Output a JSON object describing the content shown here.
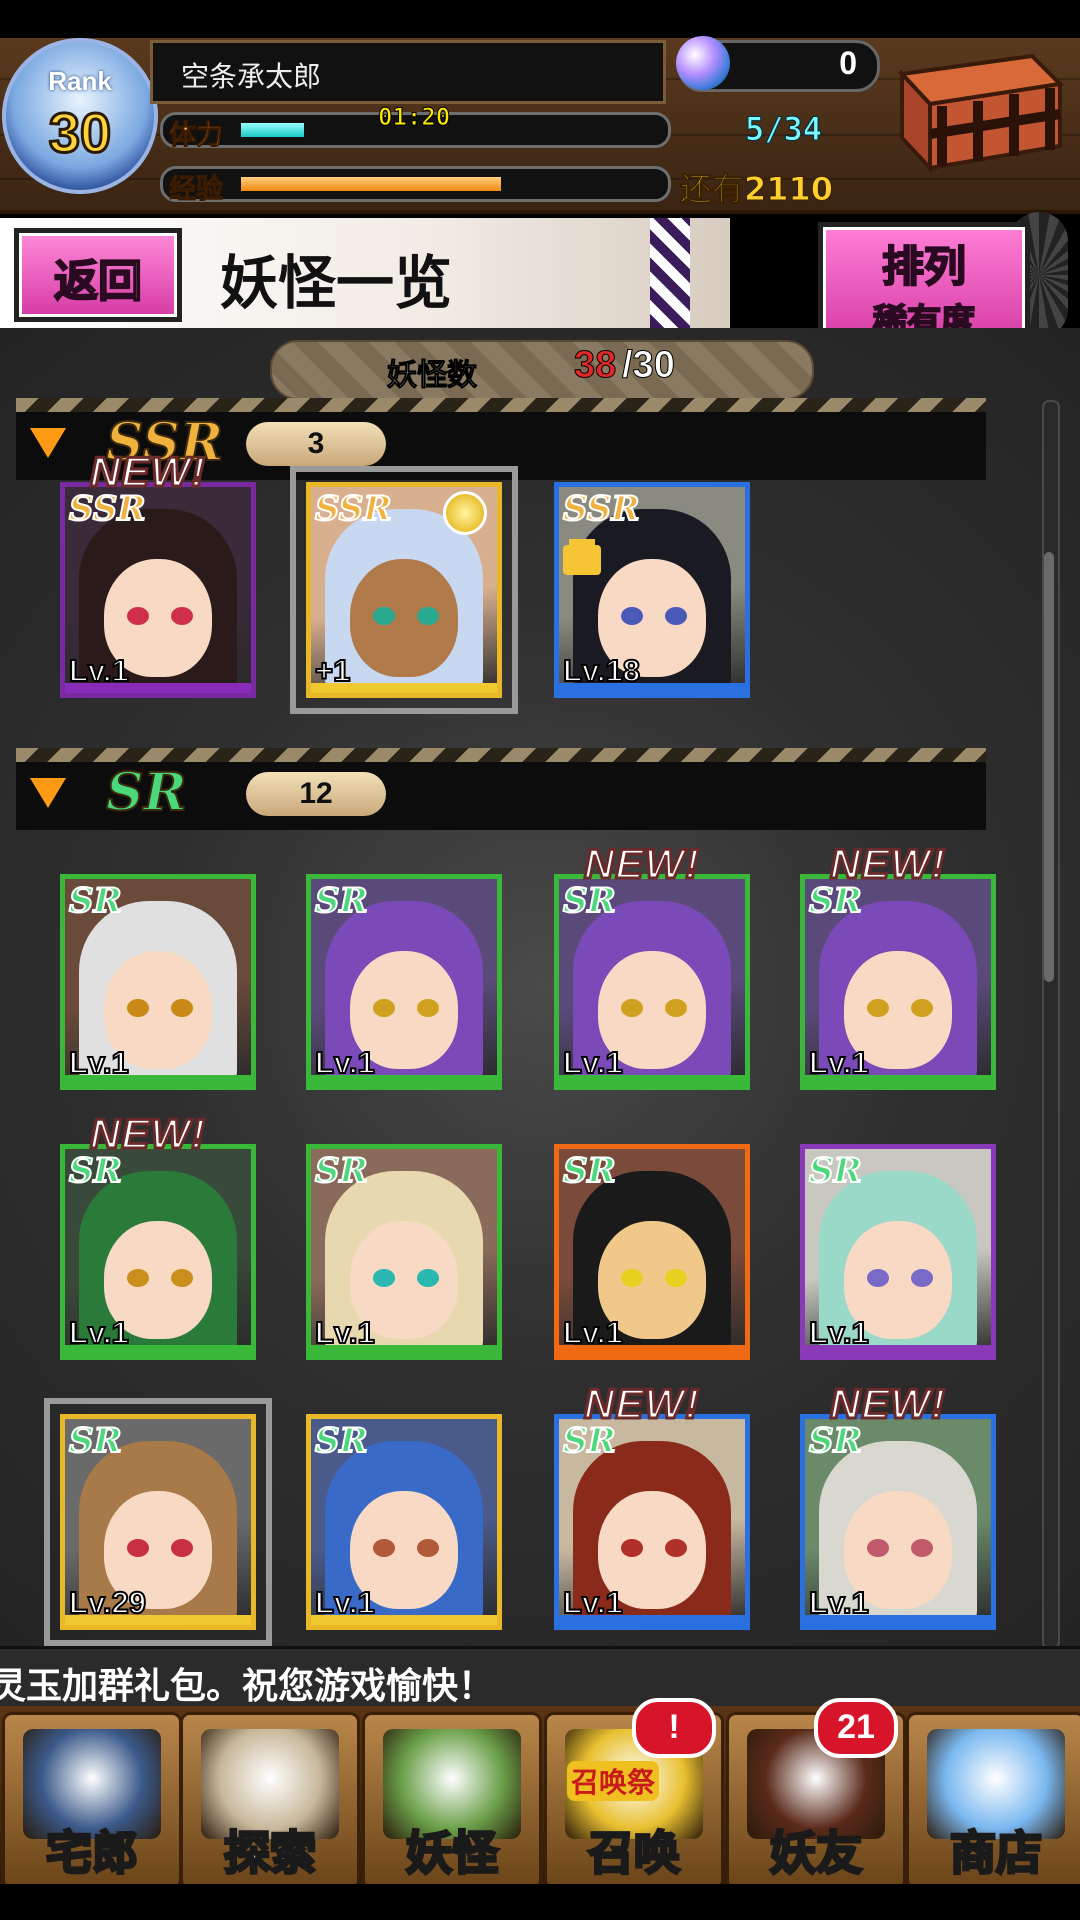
{
  "header": {
    "rank_label": "Rank",
    "rank_value": "30",
    "player_name": "空条承太郎",
    "stamina_label": "体力",
    "stamina_timer": "01:20",
    "stamina": "5/34",
    "stamina_fill": 0.15,
    "exp_label": "经验",
    "exp_fill": 0.62,
    "exp_remaining": "还有2110",
    "gems": "0"
  },
  "subheader": {
    "back_label": "返回",
    "title": "妖怪一览",
    "sort_label": "排列",
    "sort_value": "稀有度"
  },
  "counter": {
    "label": "妖怪数",
    "owned": "38",
    "capacity": "/30"
  },
  "sections": [
    {
      "rarity": "SSR",
      "count": "3",
      "color": "#f0b23c",
      "cards": [
        {
          "level": "Lv.1",
          "new": true,
          "frame": "#7a2aa0",
          "strip": "#8a2ab8",
          "hair": "#2a1a1a",
          "bg": "#3a2a3a",
          "eye": "#d0304a"
        },
        {
          "level": "+1",
          "selected": true,
          "medal": true,
          "frame": "#e8b828",
          "strip": "#f0c830",
          "hair": "#c8d8f0",
          "bg": "#d8b090",
          "eye": "#2aa890",
          "skin": "#b07a4a"
        },
        {
          "level": "Lv.18",
          "locked": true,
          "frame": "#2a70e0",
          "strip": "#2a70e0",
          "hair": "#1a1a22",
          "bg": "#8a8a80",
          "eye": "#4a5ab8"
        }
      ]
    },
    {
      "rarity": "SR",
      "count": "12",
      "color": "#4ad87a",
      "cards": [
        {
          "level": "Lv.1",
          "frame": "#3ab83a",
          "strip": "#3ab83a",
          "hair": "#e0e0e0",
          "bg": "#6a4a3a",
          "eye": "#c88a14"
        },
        {
          "level": "Lv.1",
          "frame": "#3ab83a",
          "strip": "#3ab83a",
          "hair": "#7a4ab8",
          "bg": "#5a4a7a",
          "eye": "#d0a020"
        },
        {
          "level": "Lv.1",
          "new": true,
          "frame": "#3ab83a",
          "strip": "#3ab83a",
          "hair": "#7a4ab8",
          "bg": "#5a4a7a",
          "eye": "#d0a020"
        },
        {
          "level": "Lv.1",
          "new": true,
          "frame": "#3ab83a",
          "strip": "#3ab83a",
          "hair": "#7a4ab8",
          "bg": "#5a4a7a",
          "eye": "#d0a020"
        },
        {
          "level": "Lv.1",
          "new": true,
          "frame": "#3ab83a",
          "strip": "#3ab83a",
          "hair": "#2a7a3a",
          "bg": "#3a4a3a",
          "eye": "#c8901a"
        },
        {
          "level": "Lv.1",
          "frame": "#3ab83a",
          "strip": "#3ab83a",
          "hair": "#e8d8b0",
          "bg": "#8a6a5a",
          "eye": "#2ab8b0"
        },
        {
          "level": "Lv.1",
          "frame": "#f06a14",
          "strip": "#f06a14",
          "hair": "#1a1a1a",
          "bg": "#7a4a3a",
          "eye": "#e8d020",
          "skin": "#f0c88a"
        },
        {
          "level": "Lv.1",
          "frame": "#8a3ab8",
          "strip": "#8a3ab8",
          "hair": "#9ad8c8",
          "bg": "#c8c8c0",
          "eye": "#7a6ac8"
        },
        {
          "level": "Lv.29",
          "selected": true,
          "frame": "#e8b828",
          "strip": "#f0c830",
          "hair": "#a87a4a",
          "bg": "#6a6a6a",
          "eye": "#c83040"
        },
        {
          "level": "Lv.1",
          "frame": "#e8b828",
          "strip": "#f0c830",
          "hair": "#3a6ac8",
          "bg": "#4a5a8a",
          "eye": "#b05a3a"
        },
        {
          "level": "Lv.1",
          "new": true,
          "frame": "#2a70e0",
          "strip": "#2a70e0",
          "hair": "#8a2a1a",
          "bg": "#c8b8a0",
          "eye": "#b0302a"
        },
        {
          "level": "Lv.1",
          "new": true,
          "frame": "#2a70e0",
          "strip": "#2a70e0",
          "hair": "#d8d8d0",
          "bg": "#6a8a6a",
          "eye": "#c05a6a"
        }
      ]
    }
  ],
  "new_label": "NEW!",
  "ticker": "灵玉加群礼包。祝您游戏愉快！",
  "nav": [
    {
      "label": "宅郎",
      "icon": "house-icon"
    },
    {
      "label": "探索",
      "icon": "magnifier-map-icon"
    },
    {
      "label": "妖怪",
      "icon": "scroll-icon"
    },
    {
      "label": "召唤",
      "icon": "summon-festival-icon",
      "badge": "!",
      "banner": "召唤祭"
    },
    {
      "label": "妖友",
      "icon": "friend-avatar-icon",
      "badge": "21"
    },
    {
      "label": "商店",
      "icon": "crystal-orb-icon"
    }
  ]
}
